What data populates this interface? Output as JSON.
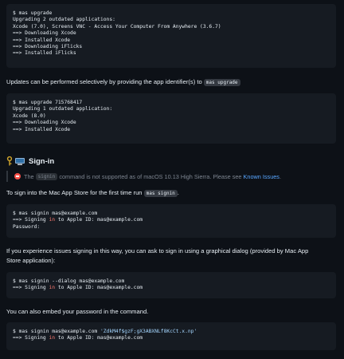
{
  "code_upgrade_all": {
    "l1": "$ mas upgrade",
    "l2": "Upgrading 2 outdated applications:",
    "l3": "Xcode (7.0), Screens VNC - Access Your Computer From Anywhere (3.6.7)",
    "l4": "==> Downloading Xcode",
    "l5": "==> Installed Xcode",
    "l6": "==> Downloading iFlicks",
    "l7": "==> Installed iFlicks"
  },
  "para_selective": {
    "text": "Updates can be performed selectively by providing the app identifier(s) to",
    "code": "mas upgrade"
  },
  "code_upgrade_one": {
    "l1": "$ mas upgrade 715768417",
    "l2": "Upgrading 1 outdated application:",
    "l3": "Xcode (8.0)",
    "l4": "==> Downloading Xcode",
    "l5": "==> Installed Xcode"
  },
  "signin_heading": {
    "title": "Sign-in",
    "icons": [
      "key-icon",
      "computer-icon"
    ]
  },
  "signin_note": {
    "icon": "no-entry-icon",
    "text_before": "The",
    "code": "signin",
    "text_after": "command is not supported as of macOS 10.13 High Sierra. Please see",
    "link": "Known Issues",
    "end": "."
  },
  "para_first_time": {
    "text": "To sign into the Mac App Store for the first time run",
    "code": "mas signin",
    "end": "."
  },
  "code_signin": {
    "l1": "$ mas signin mas@example.com",
    "l2_pre": "==> Signing ",
    "l2_kw": "in",
    "l2_post": " to Apple ID: mas@example.com",
    "l3": "Password:"
  },
  "para_dialog": {
    "line1": "If you experience issues signing in this way, you can ask to sign in using a graphical dialog (provided by Mac App",
    "line2": "Store application):"
  },
  "code_dialog": {
    "l1": "$ mas signin --dialog mas@example.com",
    "l2_pre": "==> Signing ",
    "l2_kw": "in",
    "l2_post": " to Apple ID: mas@example.com"
  },
  "para_embed": {
    "text": "You can also embed your password in the command."
  },
  "code_embed": {
    "l1_pre": "$ mas signin mas@example.com ",
    "l1_str": "'ZdkM4f$gzF;gX3ABXNLf8KcCt.x.np'",
    "l2_pre": "==> Signing ",
    "l2_kw": "in",
    "l2_post": " to Apple ID: mas@example.com"
  },
  "colors": {
    "background": "#0d1117",
    "code_background": "#161b22",
    "text": "#e6edf3",
    "keyword": "#ff7b72",
    "string": "#a5d6ff",
    "link": "#58a6ff",
    "muted": "#7d8590"
  }
}
